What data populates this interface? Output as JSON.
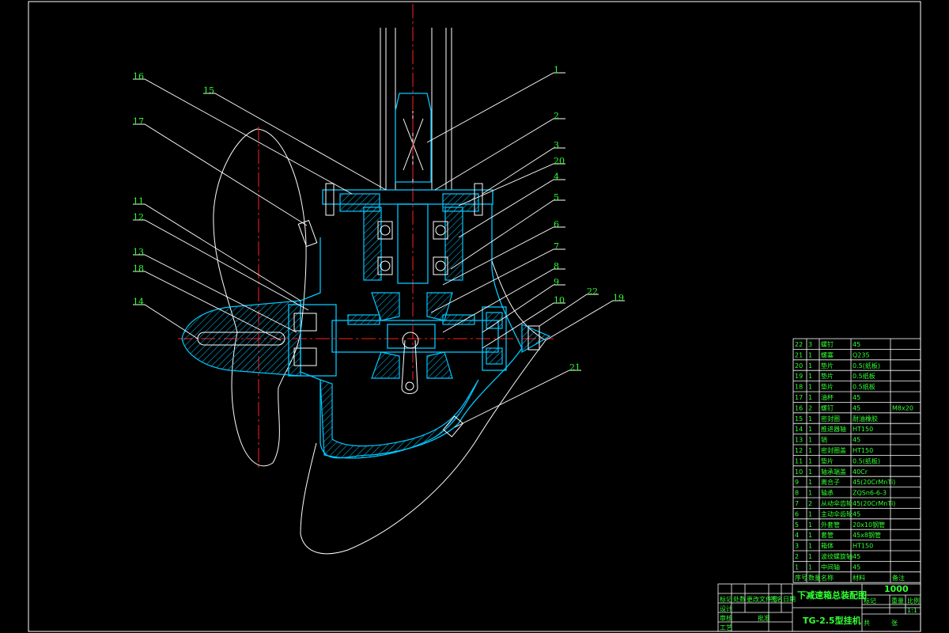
{
  "drawing": {
    "title": "下减速箱总装配图",
    "model": "TG-2.5型挂机",
    "scale": "1000"
  },
  "callouts": [
    {
      "id": "c1",
      "label": "1"
    },
    {
      "id": "c2",
      "label": "2"
    },
    {
      "id": "c3",
      "label": "3"
    },
    {
      "id": "c20",
      "label": "20"
    },
    {
      "id": "c4",
      "label": "4"
    },
    {
      "id": "c5",
      "label": "5"
    },
    {
      "id": "c6",
      "label": "6"
    },
    {
      "id": "c7",
      "label": "7"
    },
    {
      "id": "c8",
      "label": "8"
    },
    {
      "id": "c9",
      "label": "9"
    },
    {
      "id": "c10",
      "label": "10"
    },
    {
      "id": "c22",
      "label": "22"
    },
    {
      "id": "c19",
      "label": "19"
    },
    {
      "id": "c21",
      "label": "21"
    },
    {
      "id": "c16",
      "label": "16"
    },
    {
      "id": "c15",
      "label": "15"
    },
    {
      "id": "c17",
      "label": "17"
    },
    {
      "id": "c11",
      "label": "11"
    },
    {
      "id": "c12",
      "label": "12"
    },
    {
      "id": "c13",
      "label": "13"
    },
    {
      "id": "c18",
      "label": "18"
    },
    {
      "id": "c14",
      "label": "14"
    }
  ],
  "bom": [
    {
      "no": "22",
      "qty": "3",
      "name": "螺钉",
      "material": "45",
      "note": ""
    },
    {
      "no": "21",
      "qty": "1",
      "name": "螺塞",
      "material": "Q235",
      "note": ""
    },
    {
      "no": "20",
      "qty": "1",
      "name": "垫片",
      "material": "0.5(纸板)",
      "note": ""
    },
    {
      "no": "19",
      "qty": "1",
      "name": "垫片",
      "material": "0.5纸板",
      "note": ""
    },
    {
      "no": "18",
      "qty": "1",
      "name": "垫片",
      "material": "0.5纸板",
      "note": ""
    },
    {
      "no": "17",
      "qty": "1",
      "name": "油杯",
      "material": "45",
      "note": ""
    },
    {
      "no": "16",
      "qty": "2",
      "name": "螺钉",
      "material": "45",
      "note": "M8x20"
    },
    {
      "no": "15",
      "qty": "1",
      "name": "密封圈",
      "material": "耐油橡胶",
      "note": ""
    },
    {
      "no": "14",
      "qty": "1",
      "name": "推进器轴",
      "material": "HT150",
      "note": ""
    },
    {
      "no": "13",
      "qty": "1",
      "name": "销",
      "material": "45",
      "note": ""
    },
    {
      "no": "12",
      "qty": "1",
      "name": "密封圈盖",
      "material": "HT150",
      "note": ""
    },
    {
      "no": "11",
      "qty": "1",
      "name": "垫片",
      "material": "0.5(纸板)",
      "note": ""
    },
    {
      "no": "10",
      "qty": "1",
      "name": "轴承端盖",
      "material": "40Cr",
      "note": ""
    },
    {
      "no": "9",
      "qty": "1",
      "name": "离合子",
      "material": "45(20CrMnTi)",
      "note": ""
    },
    {
      "no": "8",
      "qty": "1",
      "name": "轴承",
      "material": "ZQSn6-6-3",
      "note": ""
    },
    {
      "no": "7",
      "qty": "2",
      "name": "从动伞齿轮",
      "material": "45(20CrMnTi)",
      "note": ""
    },
    {
      "no": "6",
      "qty": "1",
      "name": "主动伞齿轮",
      "material": "45",
      "note": ""
    },
    {
      "no": "5",
      "qty": "1",
      "name": "外套管",
      "material": "20x10钢管",
      "note": ""
    },
    {
      "no": "4",
      "qty": "1",
      "name": "套管",
      "material": "45x8钢管",
      "note": ""
    },
    {
      "no": "3",
      "qty": "1",
      "name": "箱体",
      "material": "HT150",
      "note": ""
    },
    {
      "no": "2",
      "qty": "1",
      "name": "波纹螺旋轴",
      "material": "45",
      "note": ""
    },
    {
      "no": "1",
      "qty": "1",
      "name": "中间轴",
      "material": "45",
      "note": ""
    }
  ],
  "bom_header": {
    "no": "序号",
    "qty": "数量",
    "name": "名称",
    "material": "材料",
    "note": "备注"
  },
  "title_block": {
    "r1c1": "标记",
    "r1c2": "处数",
    "r1c3": "更改文件号",
    "r1c4": "签名",
    "r1c5": "日期",
    "design": "设计",
    "check": "审核",
    "craft": "工艺",
    "approve": "批准",
    "mark": "标记",
    "weight": "重量",
    "ratio": "比例",
    "ratio_val": "1:1",
    "sheet": "共",
    "sheet2": "张"
  },
  "colors": {
    "outline": "#ffffff",
    "part": "#00c8ff",
    "text": "#33ff33",
    "center": "#ff2020"
  }
}
